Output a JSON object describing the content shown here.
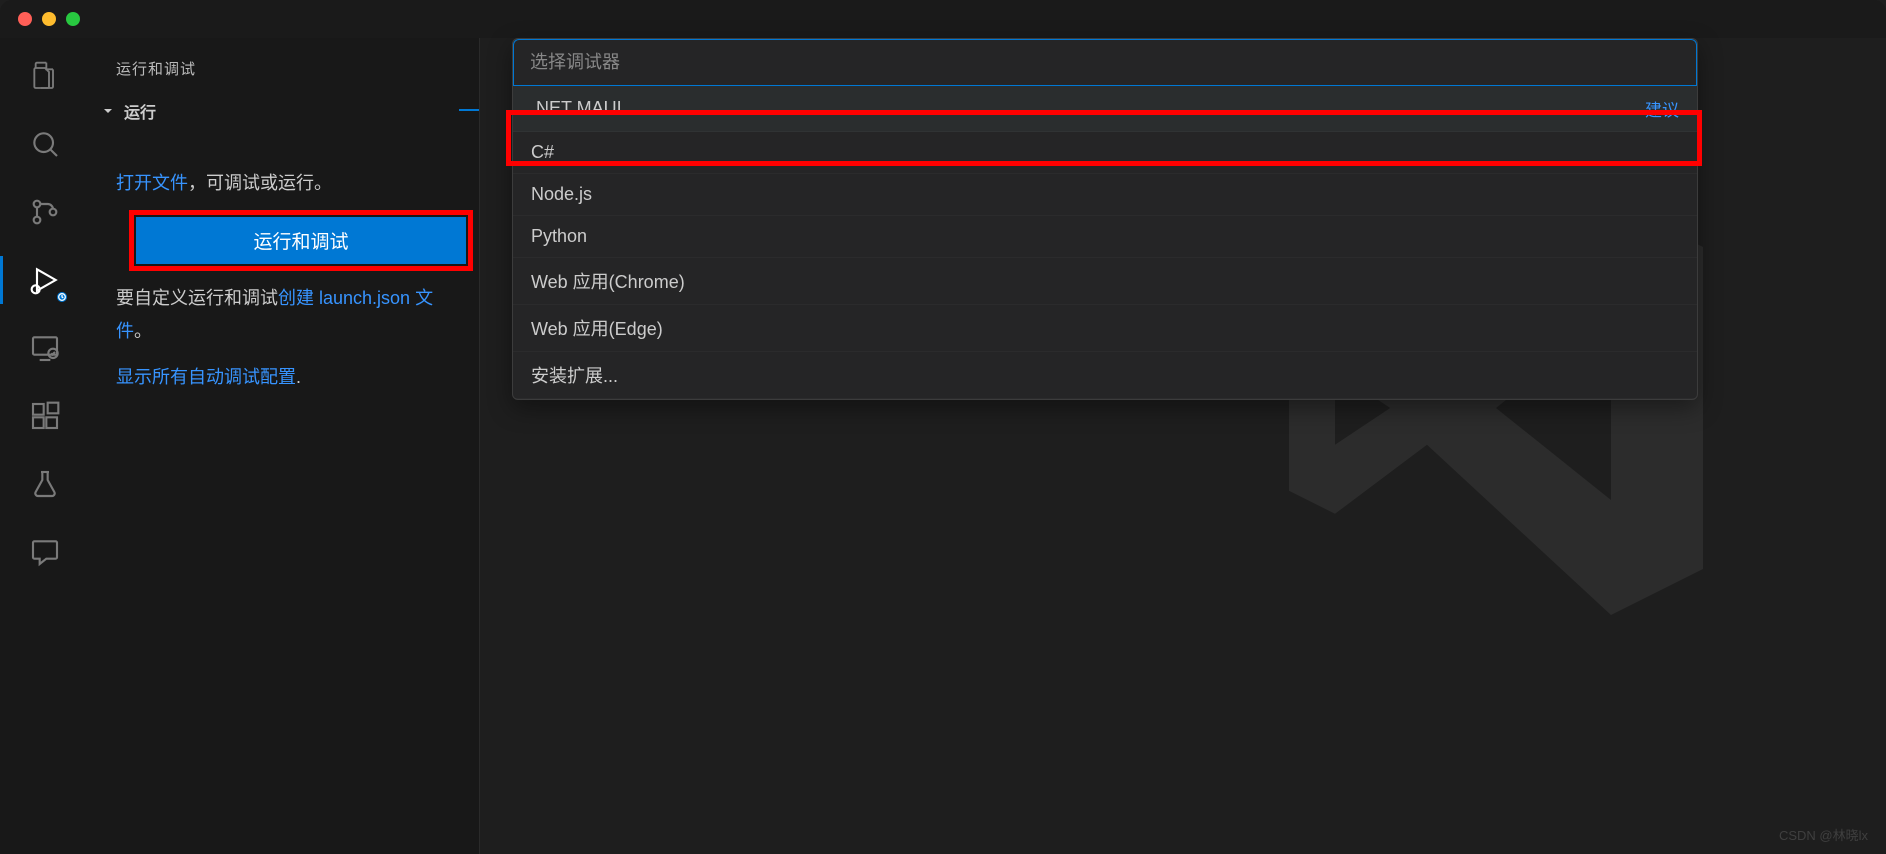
{
  "sidebar": {
    "title": "运行和调试",
    "section_label": "运行",
    "open_file_link": "打开文件",
    "open_file_suffix": "，可调试或运行。",
    "run_debug_button": "运行和调试",
    "customize_prefix": "要自定义运行和调试",
    "create_link": "创建 launch.json 文件",
    "period": "。",
    "show_all_link": "显示所有自动调试配置",
    "show_all_period": "."
  },
  "picker": {
    "placeholder": "选择调试器",
    "items": [
      {
        "label": ".NET MAUI",
        "hint": "建议"
      },
      {
        "label": "C#",
        "hint": ""
      },
      {
        "label": "Node.js",
        "hint": ""
      },
      {
        "label": "Python",
        "hint": ""
      },
      {
        "label": "Web 应用(Chrome)",
        "hint": ""
      },
      {
        "label": "Web 应用(Edge)",
        "hint": ""
      },
      {
        "label": "安装扩展...",
        "hint": ""
      }
    ]
  },
  "watermark_credit": "CSDN @林晓lx"
}
